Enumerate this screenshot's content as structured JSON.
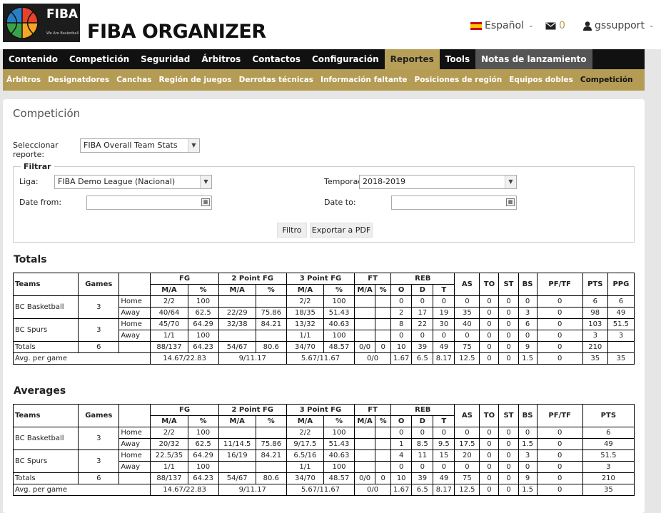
{
  "header": {
    "logo_text": "FIBA",
    "logo_tagline": "We Are Basketball",
    "app_title": "FIBA ORGANIZER",
    "language": "Español",
    "messages_count": "0",
    "user": "gssupport"
  },
  "main_nav": [
    {
      "label": "Contenido"
    },
    {
      "label": "Competición"
    },
    {
      "label": "Seguridad"
    },
    {
      "label": "Árbitros"
    },
    {
      "label": "Contactos"
    },
    {
      "label": "Configuración"
    },
    {
      "label": "Reportes",
      "active": true
    },
    {
      "label": "Tools"
    },
    {
      "label": "Notas de lanzamiento"
    }
  ],
  "sub_nav": [
    {
      "label": "Árbitros"
    },
    {
      "label": "Designatdores"
    },
    {
      "label": "Canchas"
    },
    {
      "label": "Región de juegos"
    },
    {
      "label": "Derrotas técnicas"
    },
    {
      "label": "Información faltante"
    },
    {
      "label": "Posiciones de región"
    },
    {
      "label": "Equipos dobles"
    },
    {
      "label": "Competición",
      "active": true
    }
  ],
  "page": {
    "title": "Competición",
    "report_label": "Seleccionar reporte:",
    "report_value": "FIBA Overall Team Stats",
    "filter_legend": "Filtrar",
    "liga_label": "Liga:",
    "liga_value": "FIBA Demo League (Nacional)",
    "temporada_label": "Temporada:",
    "temporada_value": "2018-2019",
    "date_from_label": "Date from:",
    "date_to_label": "Date to:",
    "filter_button": "Filtro",
    "pdf_button": "Exportar a PDF"
  },
  "headers": {
    "teams": "Teams",
    "games": "Games",
    "fg": "FG",
    "two_pt": "2 Point FG",
    "three_pt": "3 Point FG",
    "ft": "FT",
    "reb": "REB",
    "as": "AS",
    "to": "TO",
    "st": "ST",
    "bs": "BS",
    "pftf": "PF/TF",
    "pts": "PTS",
    "ppg": "PPG",
    "ma": "M/A",
    "pct": "%",
    "o": "O",
    "d": "D",
    "t": "T"
  },
  "totals": {
    "title": "Totals",
    "teams": [
      {
        "name": "BC Basketball",
        "games": "3",
        "rows": [
          {
            "venue": "Home",
            "fg_ma": "2/2",
            "fg_pct": "100",
            "p2_ma": "",
            "p2_pct": "",
            "p3_ma": "2/2",
            "p3_pct": "100",
            "ft_ma": "",
            "ft_pct": "",
            "reb_o": "0",
            "reb_d": "0",
            "reb_t": "0",
            "as": "0",
            "to": "0",
            "st": "0",
            "bs": "0",
            "pftf": "0",
            "pts": "6",
            "ppg": "6"
          },
          {
            "venue": "Away",
            "fg_ma": "40/64",
            "fg_pct": "62.5",
            "p2_ma": "22/29",
            "p2_pct": "75.86",
            "p3_ma": "18/35",
            "p3_pct": "51.43",
            "ft_ma": "",
            "ft_pct": "",
            "reb_o": "2",
            "reb_d": "17",
            "reb_t": "19",
            "as": "35",
            "to": "0",
            "st": "0",
            "bs": "3",
            "pftf": "0",
            "pts": "98",
            "ppg": "49"
          }
        ]
      },
      {
        "name": "BC Spurs",
        "games": "3",
        "rows": [
          {
            "venue": "Home",
            "fg_ma": "45/70",
            "fg_pct": "64.29",
            "p2_ma": "32/38",
            "p2_pct": "84.21",
            "p3_ma": "13/32",
            "p3_pct": "40.63",
            "ft_ma": "",
            "ft_pct": "",
            "reb_o": "8",
            "reb_d": "22",
            "reb_t": "30",
            "as": "40",
            "to": "0",
            "st": "0",
            "bs": "6",
            "pftf": "0",
            "pts": "103",
            "ppg": "51.5"
          },
          {
            "venue": "Away",
            "fg_ma": "1/1",
            "fg_pct": "100",
            "p2_ma": "",
            "p2_pct": "",
            "p3_ma": "1/1",
            "p3_pct": "100",
            "ft_ma": "",
            "ft_pct": "",
            "reb_o": "0",
            "reb_d": "0",
            "reb_t": "0",
            "as": "0",
            "to": "0",
            "st": "0",
            "bs": "0",
            "pftf": "0",
            "pts": "3",
            "ppg": "3"
          }
        ]
      }
    ],
    "totals_row": {
      "label": "Totals",
      "games": "6",
      "fg_ma": "88/137",
      "fg_pct": "64.23",
      "p2_ma": "54/67",
      "p2_pct": "80.6",
      "p3_ma": "34/70",
      "p3_pct": "48.57",
      "ft_ma": "0/0",
      "ft_pct": "0",
      "reb_o": "10",
      "reb_d": "39",
      "reb_t": "49",
      "as": "75",
      "to": "0",
      "st": "0",
      "bs": "9",
      "pftf": "0",
      "pts": "210",
      "ppg": ""
    },
    "avg_row": {
      "label": "Avg. per game",
      "fg": "14.67/22.83",
      "p2": "9/11.17",
      "p3": "5.67/11.67",
      "ft": "0/0",
      "reb_o": "1.67",
      "reb_d": "6.5",
      "reb_t": "8.17",
      "as": "12.5",
      "to": "0",
      "st": "0",
      "bs": "1.5",
      "pftf": "0",
      "pts": "35",
      "ppg": "35"
    }
  },
  "averages": {
    "title": "Averages",
    "teams": [
      {
        "name": "BC Basketball",
        "games": "3",
        "rows": [
          {
            "venue": "Home",
            "fg_ma": "2/2",
            "fg_pct": "100",
            "p2_ma": "",
            "p2_pct": "",
            "p3_ma": "2/2",
            "p3_pct": "100",
            "ft_ma": "",
            "ft_pct": "",
            "reb_o": "0",
            "reb_d": "0",
            "reb_t": "0",
            "as": "0",
            "to": "0",
            "st": "0",
            "bs": "0",
            "pftf": "0",
            "pts": "6"
          },
          {
            "venue": "Away",
            "fg_ma": "20/32",
            "fg_pct": "62.5",
            "p2_ma": "11/14.5",
            "p2_pct": "75.86",
            "p3_ma": "9/17.5",
            "p3_pct": "51.43",
            "ft_ma": "",
            "ft_pct": "",
            "reb_o": "1",
            "reb_d": "8.5",
            "reb_t": "9.5",
            "as": "17.5",
            "to": "0",
            "st": "0",
            "bs": "1.5",
            "pftf": "0",
            "pts": "49"
          }
        ]
      },
      {
        "name": "BC Spurs",
        "games": "3",
        "rows": [
          {
            "venue": "Home",
            "fg_ma": "22.5/35",
            "fg_pct": "64.29",
            "p2_ma": "16/19",
            "p2_pct": "84.21",
            "p3_ma": "6.5/16",
            "p3_pct": "40.63",
            "ft_ma": "",
            "ft_pct": "",
            "reb_o": "4",
            "reb_d": "11",
            "reb_t": "15",
            "as": "20",
            "to": "0",
            "st": "0",
            "bs": "3",
            "pftf": "0",
            "pts": "51.5"
          },
          {
            "venue": "Away",
            "fg_ma": "1/1",
            "fg_pct": "100",
            "p2_ma": "",
            "p2_pct": "",
            "p3_ma": "1/1",
            "p3_pct": "100",
            "ft_ma": "",
            "ft_pct": "",
            "reb_o": "0",
            "reb_d": "0",
            "reb_t": "0",
            "as": "0",
            "to": "0",
            "st": "0",
            "bs": "0",
            "pftf": "0",
            "pts": "3"
          }
        ]
      }
    ],
    "totals_row": {
      "label": "Totals",
      "games": "6",
      "fg_ma": "88/137",
      "fg_pct": "64.23",
      "p2_ma": "54/67",
      "p2_pct": "80.6",
      "p3_ma": "34/70",
      "p3_pct": "48.57",
      "ft_ma": "0/0",
      "ft_pct": "0",
      "reb_o": "10",
      "reb_d": "39",
      "reb_t": "49",
      "as": "75",
      "to": "0",
      "st": "0",
      "bs": "9",
      "pftf": "0",
      "pts": "210"
    },
    "avg_row": {
      "label": "Avg. per game",
      "fg": "14.67/22.83",
      "p2": "9/11.17",
      "p3": "5.67/11.67",
      "ft": "0/0",
      "reb_o": "1.67",
      "reb_d": "6.5",
      "reb_t": "8.17",
      "as": "12.5",
      "to": "0",
      "st": "0",
      "bs": "1.5",
      "pftf": "0",
      "pts": "35"
    }
  },
  "colors": {
    "nav_bg": "#111111",
    "accent_gold": "#b59c55",
    "page_bg": "#e6e6e6"
  },
  "icons": {
    "flag": "spain-flag-icon",
    "messages": "envelope-icon",
    "user": "user-icon",
    "calendar": "calendar-icon"
  }
}
